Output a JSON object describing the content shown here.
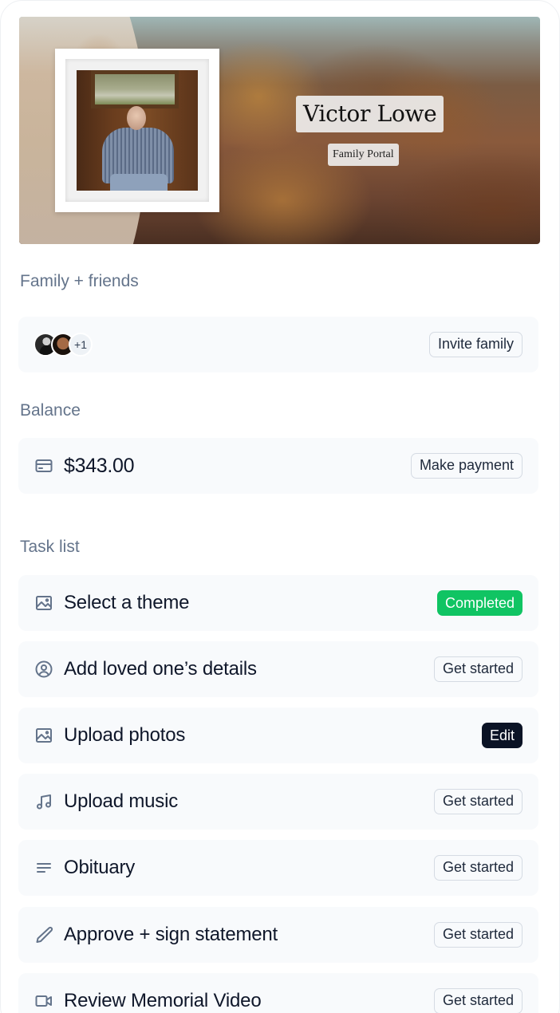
{
  "hero": {
    "name": "Victor Lowe",
    "subtitle": "Family Portal"
  },
  "family": {
    "section_label": "Family + friends",
    "extra_count": "+1",
    "invite_label": "Invite family"
  },
  "balance": {
    "section_label": "Balance",
    "amount": "$343.00",
    "pay_label": "Make payment"
  },
  "tasks": {
    "section_label": "Task list",
    "items": [
      {
        "icon": "image-icon",
        "title": "Select a theme",
        "action": "Completed",
        "status": "completed"
      },
      {
        "icon": "user-circle-icon",
        "title": "Add loved one’s details",
        "action": "Get started",
        "status": "not-started"
      },
      {
        "icon": "image-icon",
        "title": "Upload photos",
        "action": "Edit",
        "status": "in-progress"
      },
      {
        "icon": "music-note-icon",
        "title": "Upload music",
        "action": "Get started",
        "status": "not-started"
      },
      {
        "icon": "text-lines-icon",
        "title": "Obituary",
        "action": "Get started",
        "status": "not-started"
      },
      {
        "icon": "pencil-icon",
        "title": "Approve + sign statement",
        "action": "Get started",
        "status": "not-started"
      },
      {
        "icon": "video-camera-icon",
        "title": "Review Memorial Video",
        "action": "Get started",
        "status": "not-started"
      }
    ]
  },
  "colors": {
    "completed_green": "#10c463",
    "edit_dark": "#0b1325",
    "label_gray": "#64748b",
    "card_bg": "#f8fafc"
  }
}
